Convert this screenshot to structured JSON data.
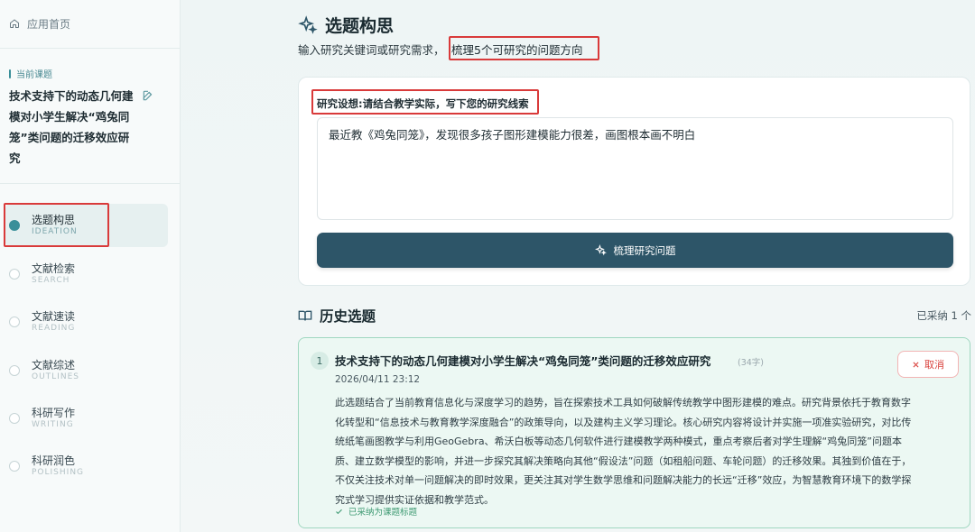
{
  "sidebar": {
    "home_label": "应用首页",
    "current_label": "当前课题",
    "current_topic": "技术支持下的动态几何建模对小学生解决“鸡兔同笼”类问题的迁移效应研究",
    "nav": [
      {
        "cn": "选题构思",
        "en": "IDEATION"
      },
      {
        "cn": "文献检索",
        "en": "SEARCH"
      },
      {
        "cn": "文献速读",
        "en": "READING"
      },
      {
        "cn": "文献综述",
        "en": "OUTLINES"
      },
      {
        "cn": "科研写作",
        "en": "WRITING"
      },
      {
        "cn": "科研润色",
        "en": "POLISHING"
      }
    ],
    "active_index": 0
  },
  "header": {
    "title": "选题构思",
    "subtitle": "输入研究关键词或研究需求，",
    "subtitle_highlight": "梳理5个可研究的问题方向"
  },
  "input_card": {
    "label": "研究设想:请结合教学实际，写下您的研究线索",
    "value": "最近教《鸡兔同笼》，发现很多孩子图形建模能力很差，画图根本画不明白",
    "button_label": "梳理研究问题"
  },
  "history": {
    "title": "历史选题",
    "adopted_count": "已采纳 1 个",
    "items": [
      {
        "index": "1",
        "topic": "技术支持下的动态几何建模对小学生解决“鸡兔同笼”类问题的迁移效应研究",
        "chars": "(34字)",
        "date": "2026/04/11 23:12",
        "description": "此选题结合了当前教育信息化与深度学习的趋势，旨在探索技术工具如何破解传统教学中图形建模的难点。研究背景依托于教育数字化转型和“信息技术与教育教学深度融合”的政策导向，以及建构主义学习理论。核心研究内容将设计并实施一项准实验研究，对比传统纸笔画图教学与利用GeoGebra、希沃白板等动态几何软件进行建模教学两种模式，重点考察后者对学生理解“鸡兔同笼”问题本质、建立数学模型的影响，并进一步探究其解决策略向其他“假设法”问题（如租船问题、车轮问题）的迁移效果。其独到价值在于，不仅关注技术对单一问题解决的即时效果，更关注其对学生数学思维和问题解决能力的长远“迁移”效应，为智慧教育环境下的数学探究式学习提供实证依据和教学范式。",
        "adopted_label": "已采纳为课题标题",
        "cancel_label": "取消"
      }
    ]
  },
  "colors": {
    "primary": "#2d5568",
    "accent": "#3a8f99",
    "highlight_border": "#d93a3a",
    "adopted_bg": "#ecf8f3"
  }
}
